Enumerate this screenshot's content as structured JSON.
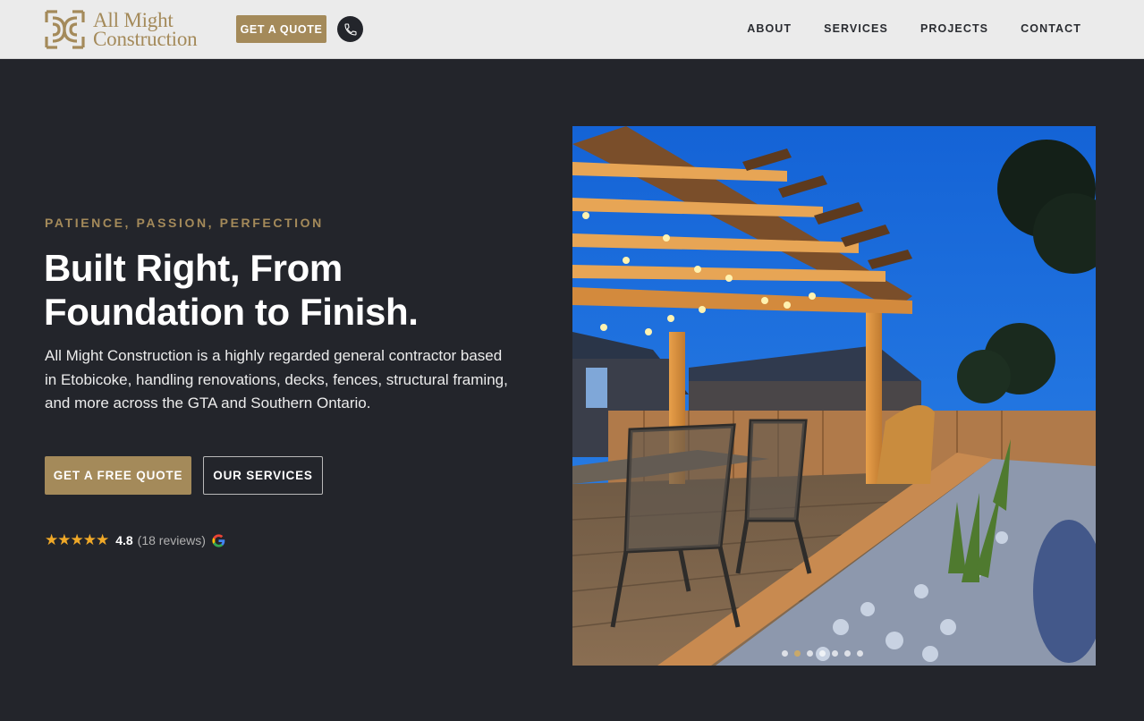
{
  "header": {
    "logo_line1": "All Might",
    "logo_line2": "Construction",
    "quote_button": "GET A QUOTE",
    "nav": [
      "ABOUT",
      "SERVICES",
      "PROJECTS",
      "CONTACT"
    ]
  },
  "hero": {
    "tagline": "PATIENCE, PASSION, PERFECTION",
    "headline_line1": "Built Right, From",
    "headline_line2": "Foundation to Finish.",
    "description": "All Might Construction is a highly regarded general contractor based in Etobicoke, handling renovations, decks, fences, structural framing, and more across the GTA and Southern Ontario.",
    "primary_button": "GET A FREE QUOTE",
    "secondary_button": "OUR SERVICES",
    "stars": "★★★★★",
    "rating": "4.8",
    "review_count": "(18 reviews)"
  },
  "slider": {
    "slide_count": 7,
    "active_index": 1
  },
  "colors": {
    "brand_gold": "#a48a5a",
    "background_dark": "#23252b",
    "header_bg": "#ebebeb",
    "star": "#f0a928"
  }
}
